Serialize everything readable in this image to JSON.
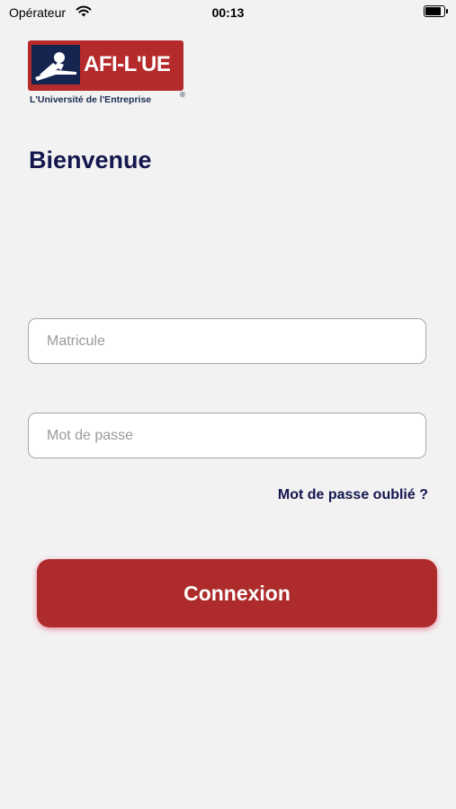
{
  "status_bar": {
    "carrier": "Opérateur",
    "time": "00:13",
    "battery_level": 0.85
  },
  "logo": {
    "brand": "AFI-L'UE",
    "tagline": "L'Université de l'Entreprise",
    "registered": "®"
  },
  "screen": {
    "title": "Bienvenue"
  },
  "form": {
    "matricule_placeholder": "Matricule",
    "matricule_value": "",
    "password_placeholder": "Mot de passe",
    "password_value": "",
    "forgot_label": "Mot de passe oublié ?",
    "submit_label": "Connexion"
  },
  "colors": {
    "brand_red": "#ad2b2b",
    "navy": "#14164e",
    "background": "#f2f2f2"
  }
}
